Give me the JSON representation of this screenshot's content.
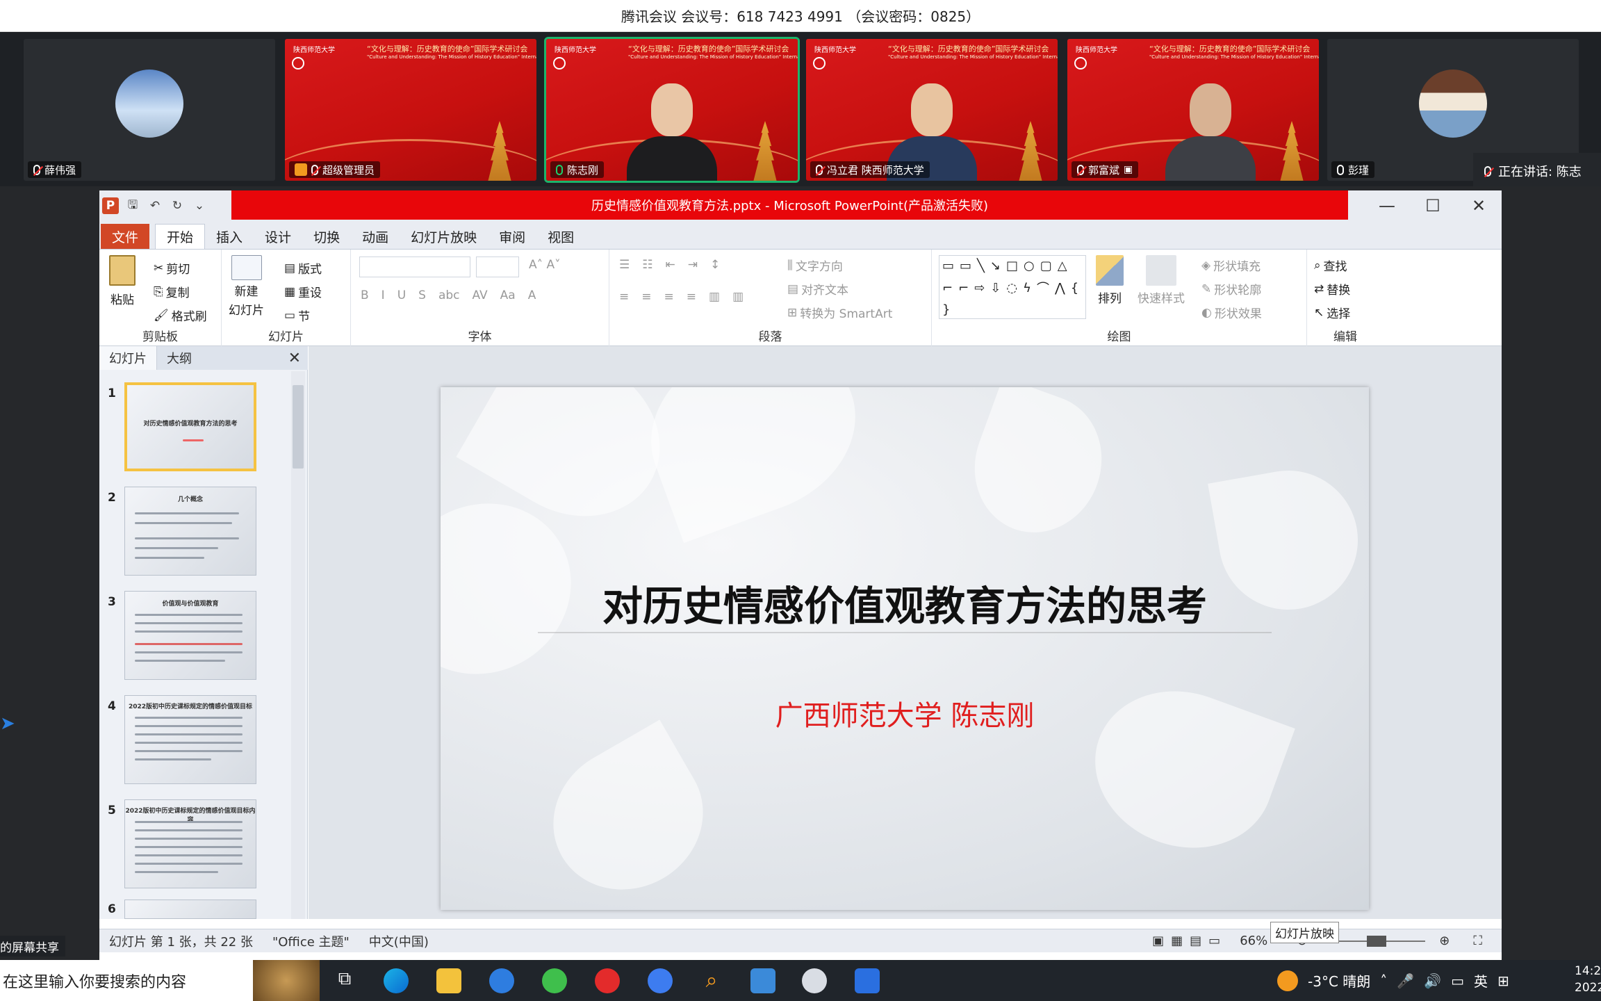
{
  "meeting": {
    "title": "腾讯会议 会议号：618 7423 4991 （会议密码：0825）",
    "speaking": "正在讲话: 陈志",
    "participants": [
      {
        "name": "薛伟强",
        "type": "avatar"
      },
      {
        "name": "超级管理员",
        "type": "banner",
        "host": true
      },
      {
        "name": "陈志刚",
        "type": "video",
        "active": true
      },
      {
        "name": "冯立君 陕西师范大学",
        "type": "video"
      },
      {
        "name": "郭富斌",
        "type": "video"
      },
      {
        "name": "彭瑾",
        "type": "avatar"
      }
    ],
    "banner": {
      "university": "陕西师范大学",
      "conference": "“文化与理解：历史教育的使命”国际学术研讨会",
      "conference_en": "\"Culture and Understanding: The Mission of History Education\" International Conference"
    }
  },
  "ppt": {
    "window_title": "历史情感价值观教育方法.pptx - Microsoft PowerPoint(产品激活失败)",
    "tabs": [
      "文件",
      "开始",
      "插入",
      "设计",
      "切换",
      "动画",
      "幻灯片放映",
      "审阅",
      "视图"
    ],
    "ribbon": {
      "clipboard": {
        "paste": "粘贴",
        "cut": "剪切",
        "copy": "复制",
        "format_painter": "格式刷",
        "label": "剪贴板"
      },
      "slides": {
        "new_slide": "新建",
        "new_slide2": "幻灯片",
        "layout": "版式",
        "reset": "重设",
        "section": "节",
        "label": "幻灯片"
      },
      "font": {
        "label": "字体"
      },
      "paragraph": {
        "text_direction": "文字方向",
        "align_text": "对齐文本",
        "smartart": "转换为 SmartArt",
        "label": "段落"
      },
      "drawing": {
        "arrange": "排列",
        "quick_styles": "快速样式",
        "shape_fill": "形状填充",
        "shape_outline": "形状轮廓",
        "shape_effects": "形状效果",
        "label": "绘图"
      },
      "editing": {
        "find": "查找",
        "replace": "替换",
        "select": "选择",
        "label": "编辑"
      }
    },
    "pane_tabs": [
      "幻灯片",
      "大纲"
    ],
    "thumbnails": [
      {
        "num": "1",
        "title": "对历史情感价值观教育方法的思考"
      },
      {
        "num": "2",
        "title": "几个概念"
      },
      {
        "num": "3",
        "title": "价值观与价值观教育"
      },
      {
        "num": "4",
        "title": "2022版初中历史课标规定的情感价值观目标"
      },
      {
        "num": "5",
        "title": "2022版初中历史课标规定的情感价值观目标内容"
      },
      {
        "num": "6",
        "title": ""
      }
    ],
    "slide": {
      "title": "对历史情感价值观教育方法的思考",
      "subtitle": "广西师范大学  陈志刚"
    },
    "status": {
      "slide_info": "幻灯片 第 1 张，共 22 张",
      "theme": "\"Office 主题\"",
      "language": "中文(中国)",
      "zoom": "66%",
      "tooltip": "幻灯片放映"
    }
  },
  "share_hint": "的屏幕共享",
  "taskbar": {
    "search_placeholder": "在这里输入你要搜索的内容",
    "weather": "-3°C  晴朗",
    "ime": "英",
    "time": "14:2",
    "date": "2022/1"
  },
  "colors": {
    "ppt_accent": "#d24726",
    "title_highlight": "#e8060a",
    "subtitle_red": "#e01e1e",
    "active_speaker": "#1bb56b"
  }
}
